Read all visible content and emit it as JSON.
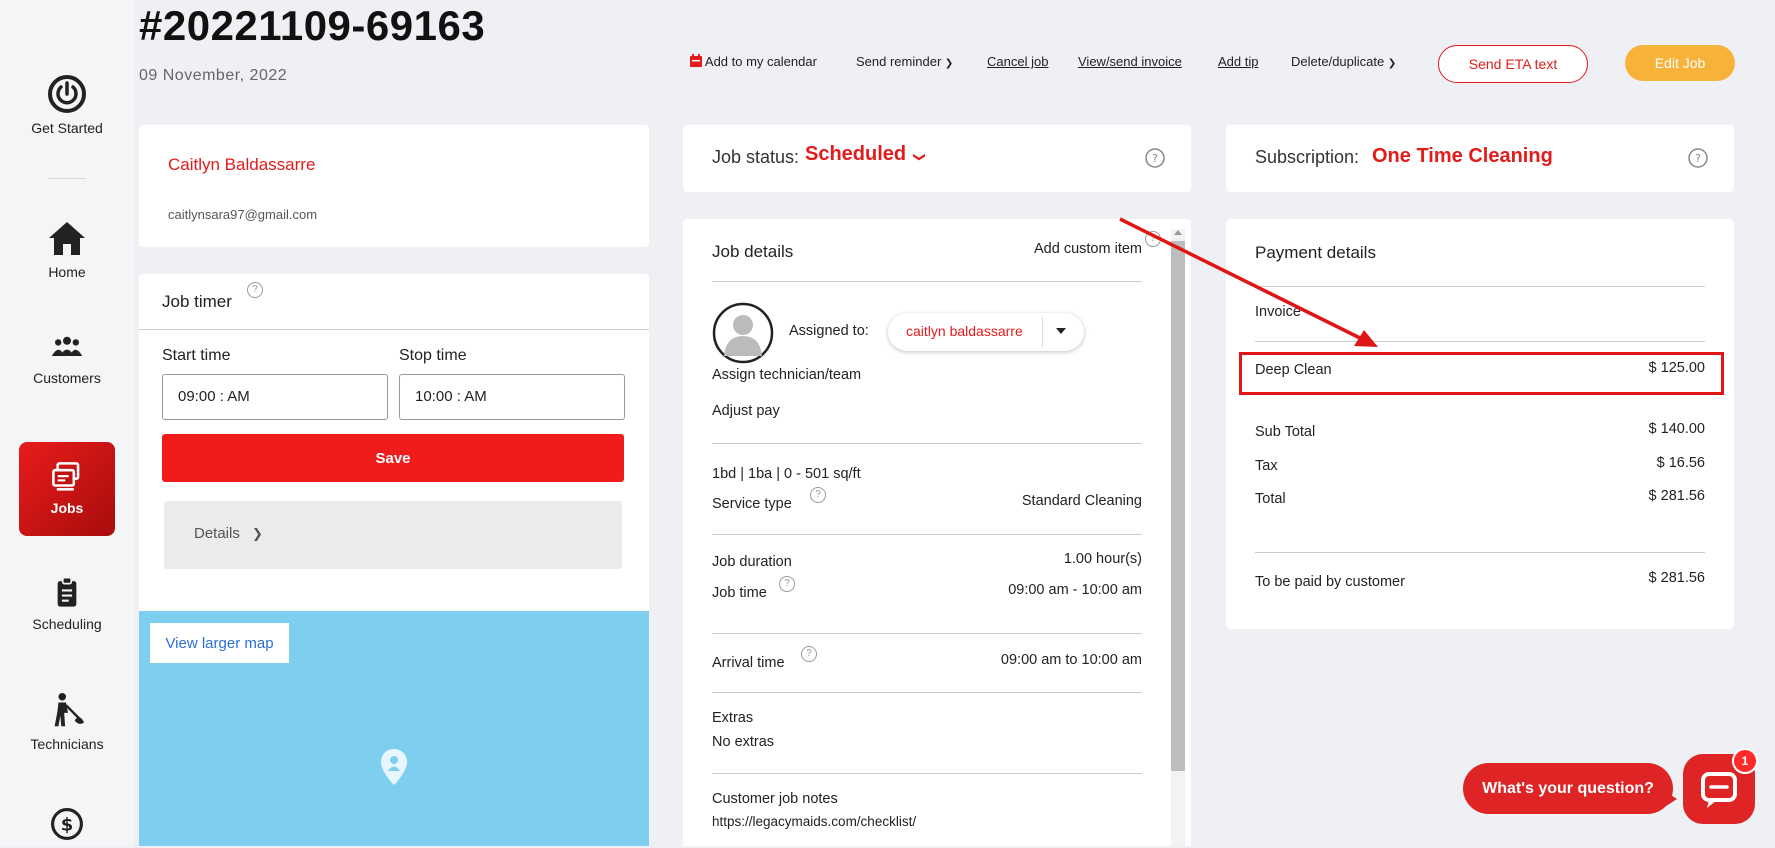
{
  "sidebar": {
    "items": [
      {
        "label": "Get Started",
        "icon": "power-icon"
      },
      {
        "label": "Home",
        "icon": "home-icon"
      },
      {
        "label": "Customers",
        "icon": "customers-icon"
      },
      {
        "label": "Jobs",
        "icon": "jobs-icon",
        "active": true
      },
      {
        "label": "Scheduling",
        "icon": "clipboard-icon"
      },
      {
        "label": "Technicians",
        "icon": "technician-icon"
      }
    ]
  },
  "header": {
    "job_number": "#20221109-69163",
    "date": "09 November, 2022",
    "actions": {
      "calendar": "Add to my calendar",
      "reminder": "Send reminder",
      "cancel": "Cancel job",
      "invoice": "View/send invoice",
      "tip": "Add tip",
      "delete": "Delete/duplicate",
      "send_eta": "Send ETA text",
      "edit": "Edit Job"
    }
  },
  "customer": {
    "name": "Caitlyn Baldassarre",
    "email": "caitlynsara97@gmail.com"
  },
  "timer": {
    "title": "Job timer",
    "start_label": "Start time",
    "stop_label": "Stop time",
    "start_value": "09:00 : AM",
    "stop_value": "10:00 : AM",
    "save_label": "Save",
    "details_label": "Details"
  },
  "map": {
    "link": "View larger map"
  },
  "status": {
    "label": "Job status:",
    "value": "Scheduled"
  },
  "job_details": {
    "title": "Job details",
    "add_custom": "Add custom item",
    "assigned_label": "Assigned to:",
    "assigned_value": "caitlyn baldassarre",
    "assign_link": "Assign technician/team",
    "adjust_pay": "Adjust pay",
    "home_size": "1bd | 1ba | 0 - 501 sq/ft",
    "service_type_label": "Service type",
    "service_type_value": "Standard Cleaning",
    "duration_label": "Job duration",
    "duration_value": "1.00 hour(s)",
    "time_label": "Job time",
    "time_value": "09:00 am - 10:00 am",
    "arrival_label": "Arrival time",
    "arrival_value": "09:00 am to 10:00 am",
    "extras_label": "Extras",
    "extras_value": "No extras",
    "notes_label": "Customer job notes",
    "notes_value": "https://legacymaids.com/checklist/"
  },
  "subscription": {
    "label": "Subscription:",
    "value": "One Time Cleaning"
  },
  "payment": {
    "title": "Payment details",
    "invoice_label": "Invoice",
    "item_label": "Deep Clean",
    "item_value": "$ 125.00",
    "subtotal_label": "Sub Total",
    "subtotal_value": "$ 140.00",
    "tax_label": "Tax",
    "tax_value": "$ 16.56",
    "total_label": "Total",
    "total_value": "$ 281.56",
    "to_pay_label": "To be paid by customer",
    "to_pay_value": "$ 281.56"
  },
  "chat": {
    "prompt": "What's your question?",
    "badge": "1"
  },
  "colors": {
    "accent": "#e21b1b",
    "edit_button": "#f7b23a",
    "map": "#7ecfef",
    "annotation": "#e01515"
  }
}
